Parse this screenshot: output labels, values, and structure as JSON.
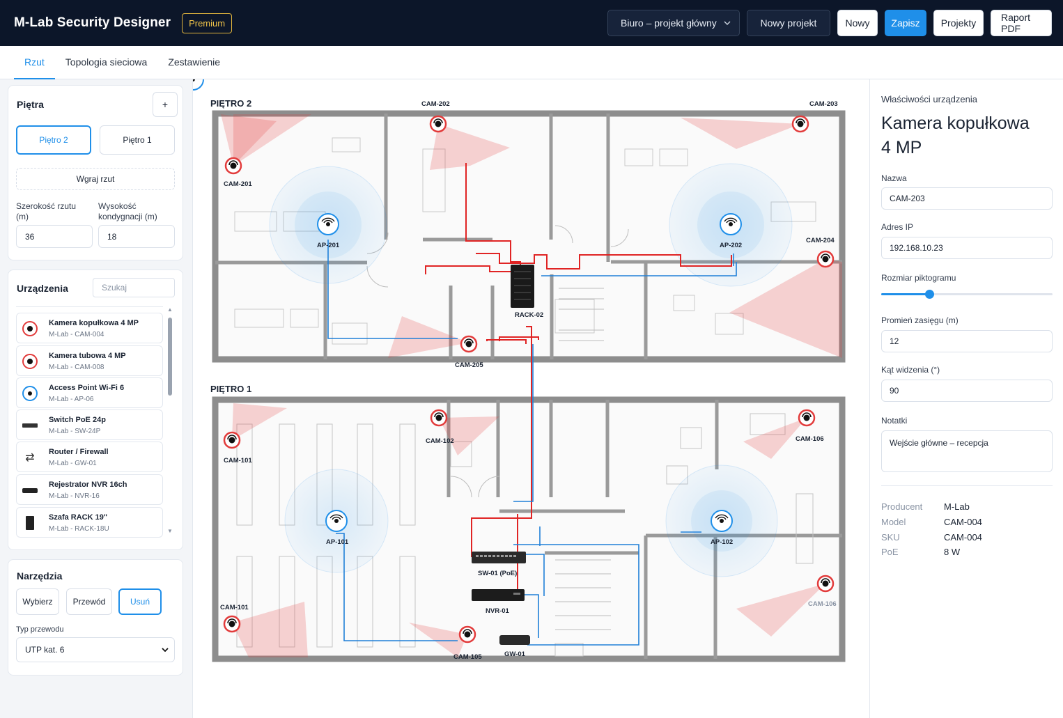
{
  "app": {
    "title": "M-Lab Security Designer",
    "badge": "Premium"
  },
  "toolbar": {
    "project_select": "Biuro – projekt główny",
    "new_project": "Nowy projekt",
    "new": "Nowy",
    "save": "Zapisz",
    "projects": "Projekty",
    "report": "Raport PDF"
  },
  "tabs": [
    {
      "label": "Rzut",
      "active": true
    },
    {
      "label": "Topologia sieciowa",
      "active": false
    },
    {
      "label": "Zestawienie",
      "active": false
    }
  ],
  "floors_panel": {
    "title": "Piętra",
    "add": "+",
    "floors": [
      "Piętro 2",
      "Piętro 1"
    ],
    "active_floor": "Piętro 2",
    "upload": "Wgraj rzut",
    "width_label": "Szerokość rzutu (m)",
    "height_label": "Wysokość kondygnacji (m)",
    "width_value": "36",
    "height_value": "18"
  },
  "devices_panel": {
    "title": "Urządzenia",
    "search_placeholder": "Szukaj",
    "items": [
      {
        "name": "Kamera kopułkowa 4 MP",
        "sku": "M-Lab - CAM-004",
        "icon": "dome-camera-icon"
      },
      {
        "name": "Kamera tubowa 4 MP",
        "sku": "M-Lab - CAM-008",
        "icon": "bullet-camera-icon"
      },
      {
        "name": "Access Point Wi-Fi 6",
        "sku": "M-Lab - AP-06",
        "icon": "access-point-icon"
      },
      {
        "name": "Switch PoE 24p",
        "sku": "M-Lab - SW-24P",
        "icon": "switch-icon"
      },
      {
        "name": "Router / Firewall",
        "sku": "M-Lab - GW-01",
        "icon": "router-icon"
      },
      {
        "name": "Rejestrator NVR 16ch",
        "sku": "M-Lab - NVR-16",
        "icon": "nvr-icon"
      },
      {
        "name": "Szafa RACK 19\"",
        "sku": "M-Lab - RACK-18U",
        "icon": "rack-icon"
      }
    ]
  },
  "tools_panel": {
    "title": "Narzędzia",
    "tools": [
      "Wybierz",
      "Przewód",
      "Usuń"
    ],
    "active_tool": "Usuń",
    "cable_label": "Typ przewodu",
    "cable_value": "UTP kat. 6"
  },
  "floorplan": {
    "floor2_title": "PIĘTRO 2",
    "floor1_title": "PIĘTRO 1",
    "labels": {
      "cam201": "CAM-201",
      "cam202": "CAM-202",
      "cam203": "CAM-203",
      "cam204": "CAM-204",
      "cam205": "CAM-205",
      "ap201": "AP-201",
      "ap202": "AP-202",
      "rack02": "RACK-02",
      "cam101a": "CAM-101",
      "cam101b": "CAM-101",
      "cam102": "CAM-102",
      "cam105": "CAM-105",
      "cam106a": "CAM-106",
      "cam106b": "CAM-106",
      "ap101": "AP-101",
      "ap102": "AP-102",
      "sw01": "SW-01 (PoE)",
      "nvr01": "NVR-01",
      "gw01": "GW-01"
    },
    "colors": {
      "camera": "#e23b3b",
      "ap": "#1f8fe9",
      "cable_red": "#e02424",
      "cable_blue": "#1f7fd8"
    }
  },
  "properties": {
    "section": "Właściwości urządzenia",
    "device_title": "Kamera kopułkowa 4 MP",
    "name_label": "Nazwa",
    "name_value": "CAM-203",
    "ip_label": "Adres IP",
    "ip_value": "192.168.10.23",
    "icon_size_label": "Rozmiar piktogramu",
    "icon_size_fraction": 0.28,
    "range_label": "Promień zasięgu (m)",
    "range_value": "12",
    "angle_label": "Kąt widzenia (°)",
    "angle_value": "90",
    "notes_label": "Notatki",
    "notes_value": "Wejście główne – recepcja",
    "meta": [
      {
        "k": "Producent",
        "v": "M-Lab"
      },
      {
        "k": "Model",
        "v": "CAM-004"
      },
      {
        "k": "SKU",
        "v": "CAM-004"
      },
      {
        "k": "PoE",
        "v": "8 W"
      }
    ]
  }
}
